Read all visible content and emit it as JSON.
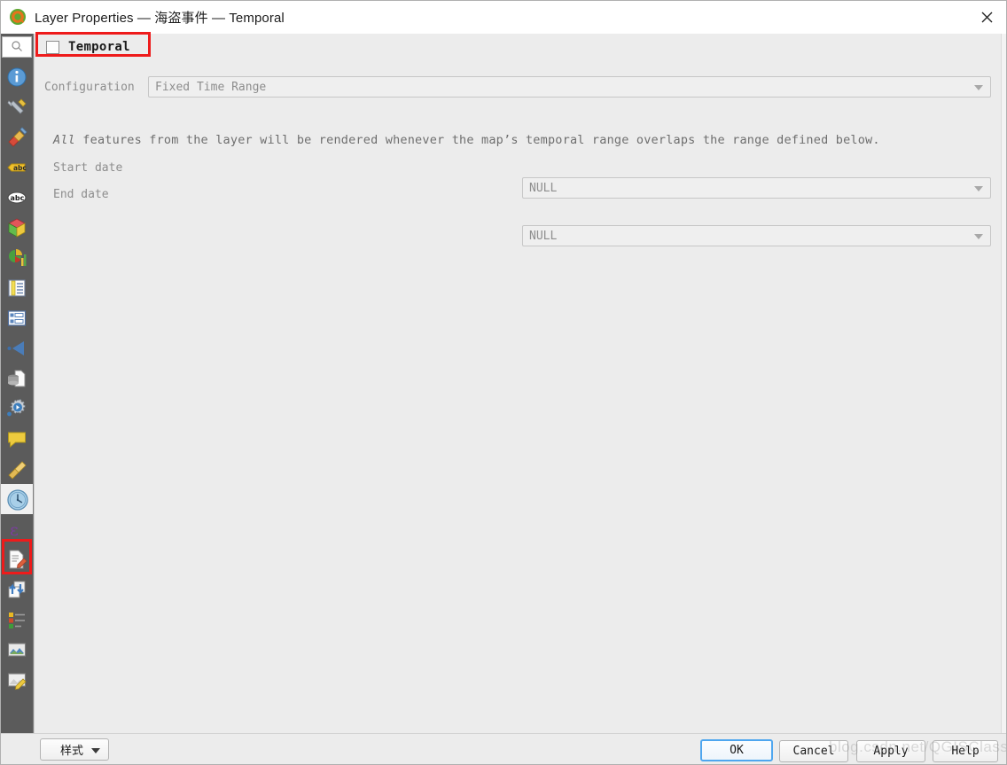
{
  "window": {
    "title": "Layer Properties — 海盗事件 — Temporal",
    "logo_icon": "qgis-logo-icon",
    "close_label": "✕"
  },
  "sidebar": {
    "search_placeholder": "",
    "search_icon": "search-icon",
    "items": [
      {
        "name": "information",
        "icon": "information-icon",
        "label": "Information"
      },
      {
        "name": "source",
        "icon": "wrench-screwdriver-icon",
        "label": "Source"
      },
      {
        "name": "symbology",
        "icon": "paintbrush-icon",
        "label": "Symbology"
      },
      {
        "name": "labels",
        "icon": "abc-label-icon",
        "label": "Labels"
      },
      {
        "name": "masks",
        "icon": "abc-mask-icon",
        "label": "Masks"
      },
      {
        "name": "3d-view",
        "icon": "cube-icon",
        "label": "3D View"
      },
      {
        "name": "diagrams",
        "icon": "pie-bar-chart-icon",
        "label": "Diagrams"
      },
      {
        "name": "fields",
        "icon": "fields-table-icon",
        "label": "Fields"
      },
      {
        "name": "attributes-form",
        "icon": "attributes-form-icon",
        "label": "Attributes Form"
      },
      {
        "name": "joins",
        "icon": "join-triangle-icon",
        "label": "Joins"
      },
      {
        "name": "auxiliary-storage",
        "icon": "database-document-icon",
        "label": "Auxiliary Storage"
      },
      {
        "name": "actions",
        "icon": "gear-play-icon",
        "label": "Actions"
      },
      {
        "name": "display",
        "icon": "speech-bubble-icon",
        "label": "Display"
      },
      {
        "name": "rendering",
        "icon": "broom-icon",
        "label": "Rendering"
      },
      {
        "name": "temporal",
        "icon": "clock-icon",
        "label": "Temporal",
        "selected": true
      },
      {
        "name": "variables",
        "icon": "epsilon-icon",
        "label": "Variables"
      },
      {
        "name": "metadata",
        "icon": "document-pencil-icon",
        "label": "Metadata"
      },
      {
        "name": "dependencies",
        "icon": "sync-arrows-icon",
        "label": "Dependencies"
      },
      {
        "name": "legend",
        "icon": "legend-swatches-icon",
        "label": "Legend"
      },
      {
        "name": "qgis-server",
        "icon": "map-image-icon",
        "label": "QGIS Server"
      },
      {
        "name": "digitizing",
        "icon": "map-pencil-icon",
        "label": "Digitizing"
      }
    ]
  },
  "main": {
    "group_title": "Temporal",
    "group_checked": false,
    "configuration_label": "Configuration",
    "configuration_value": "Fixed Time Range",
    "description_emphasis": "All",
    "description_rest": " features from the layer will be rendered whenever the map’s temporal range overlaps the range defined below.",
    "start_date_label": "Start date",
    "start_date_value": "NULL",
    "end_date_label": "End date",
    "end_date_value": "NULL"
  },
  "footer": {
    "style_label": "样式",
    "ok_label": "OK",
    "cancel_label": "Cancel",
    "apply_label": "Apply",
    "help_label": "Help"
  },
  "watermark": {
    "text": "blog.csdn.net/QGISClass"
  },
  "colors": {
    "sidebar_bg": "#5b5b5b",
    "panel_bg": "#ececec",
    "annotation_red": "#ee1b1b",
    "default_button_border": "#4ea6ef"
  }
}
